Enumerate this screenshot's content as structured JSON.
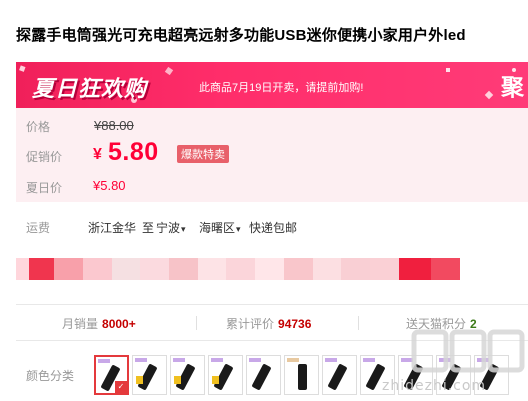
{
  "product": {
    "title": "探露手电筒强光可充电超亮远射多功能USB迷你便携小家用户外led"
  },
  "promo": {
    "banner_title": "夏日狂欢购",
    "notice": "此商品7月19日开卖，请提前加购!",
    "tag": "聚",
    "colors": {
      "primary": "#ff2d6a",
      "dark": "#b5003a"
    }
  },
  "prices": {
    "original_label": "价格",
    "original_value": "¥88.00",
    "promo_label": "促销价",
    "promo_currency": "¥",
    "promo_value": "5.80",
    "promo_badge": "爆款特卖",
    "summer_label": "夏日价",
    "summer_value": "¥5.80",
    "accent_color": "#ff0036"
  },
  "shipping": {
    "label": "运费",
    "from": "浙江金华",
    "to_label": "至",
    "destination": "宁波",
    "district": "海曙区",
    "fee_text": "快递包邮"
  },
  "stats": {
    "monthly_sales_label": "月销量",
    "monthly_sales_value": "8000+",
    "reviews_label": "累计评价",
    "reviews_value": "94736",
    "points_label": "送天猫积分",
    "points_value": "2"
  },
  "color_options": {
    "label": "颜色分类",
    "selected_index": 0,
    "count": 12
  },
  "watermark": {
    "text": "zhidezhi.com",
    "logo_glyphs": "值值值"
  }
}
